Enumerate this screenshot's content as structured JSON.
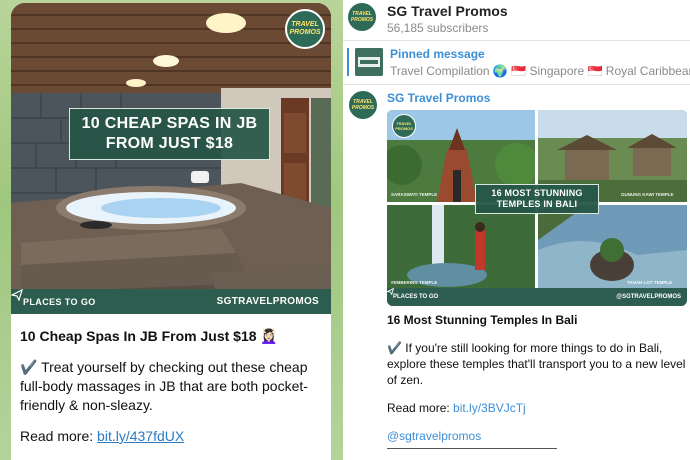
{
  "left_post": {
    "image_banner_line1": "10 CHEAP SPAS IN JB",
    "image_banner_line2": "FROM JUST $18",
    "image_footer_left": "PLACES TO GO",
    "image_footer_right": "SGTRAVELPROMOS",
    "logo_text_1": "TRAVEL",
    "logo_text_2": "PROMOS",
    "title": "10 Cheap Spas In JB From Just $18 💆🏻‍♀️",
    "body": "✔️ Treat yourself by checking out these cheap full-body massages in JB that are both pocket-friendly & non-sleazy.",
    "read_more_label": "Read more: ",
    "read_more_link": "bit.ly/437fdUX"
  },
  "channel": {
    "name": "SG Travel Promos",
    "subscribers": "56,185 subscribers"
  },
  "pinned": {
    "label": "Pinned message",
    "text": "Travel Compilation 🌍 🇸🇬 Singapore 🇸🇬 Royal Caribbean"
  },
  "right_post": {
    "author": "SG Travel Promos",
    "image_banner_line1": "16 MOST STUNNING",
    "image_banner_line2": "TEMPLES IN BALI",
    "image_footer_left": "PLACES TO GO",
    "image_footer_right": "@SGTRAVELPROMOS",
    "caption_1": "SARASWATI TEMPLE",
    "caption_2": "GUNUNG KAWI TEMPLE",
    "caption_3": "#EMBERING TEMPLE",
    "caption_4": "TANAH LOT TEMPLE",
    "title": "16 Most Stunning Temples In Bali",
    "body": "✔️ If you're still looking for more things to do in Bali, explore these temples that'll transport you to a new level of zen.",
    "read_more_label": "Read more: ",
    "read_more_link": "bit.ly/3BVJcTj",
    "handle": "@sgtravelpromos"
  },
  "colors": {
    "brand_green": "#2d5d4f",
    "link_blue": "#3d8fd6",
    "left_link_blue": "#2a79c2",
    "chat_background": "#a7cb86"
  },
  "icons": [
    "send-icon",
    "channel-avatar",
    "pinned-thumbnail"
  ]
}
